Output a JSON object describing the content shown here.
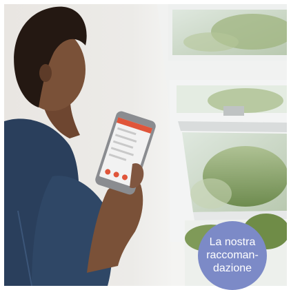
{
  "photo": {
    "subject": "woman-holding-smartphone-controlling-roof-window",
    "colors": {
      "wall": "#ecebe8",
      "window_frame": "#f3f4f4",
      "foliage": "#7f9a58",
      "shirt": "#2a3f5c",
      "skin": "#7a5138",
      "hair": "#241812",
      "phone_body": "#8a8c90",
      "phone_screen": "#f2f2f2",
      "app_accent": "#e0553a"
    }
  },
  "badge": {
    "line1": "La nostra",
    "line2": "raccoman-",
    "line3": "dazione",
    "color": "#7c8ac7"
  }
}
